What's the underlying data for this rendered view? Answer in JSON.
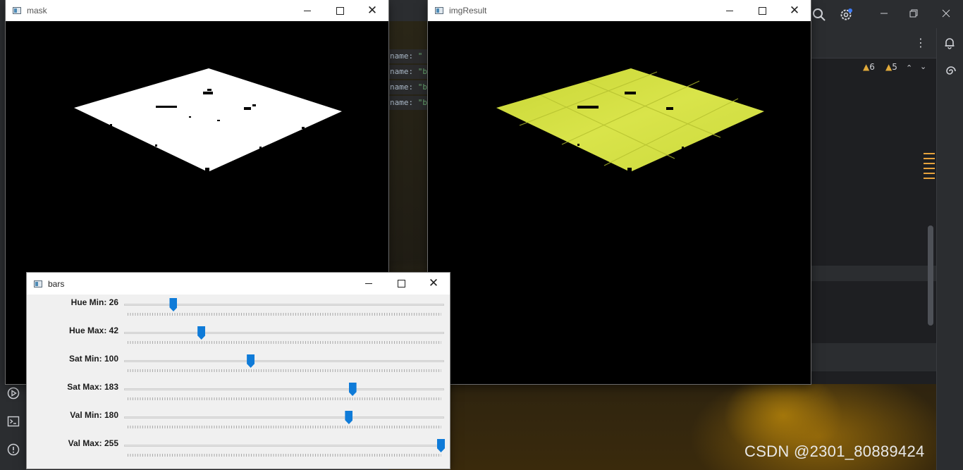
{
  "windows": {
    "mask": {
      "title": "mask"
    },
    "imgResult": {
      "title": "imgResult"
    },
    "bars": {
      "title": "bars"
    }
  },
  "sliders": [
    {
      "label": "Hue Min: 26",
      "value": 26,
      "max": 179
    },
    {
      "label": "Hue Max: 42",
      "value": 42,
      "max": 179
    },
    {
      "label": "Sat Min: 100",
      "value": 100,
      "max": 255
    },
    {
      "label": "Sat Max: 183",
      "value": 183,
      "max": 255
    },
    {
      "label": "Val Min: 180",
      "value": 180,
      "max": 255
    },
    {
      "label": "Val Max: 255",
      "value": 255,
      "max": 255
    }
  ],
  "ide": {
    "code_lines": [
      {
        "key": "name:",
        "value": "\""
      },
      {
        "key": "name:",
        "value": "\"b"
      },
      {
        "key": "name:",
        "value": "\"b"
      },
      {
        "key": "name:",
        "value": "\"b"
      }
    ],
    "warnings_count": "6",
    "weak_warnings_count": "5"
  },
  "icons": {
    "search": "search-icon",
    "settings": "gear-icon",
    "notifications": "bell-icon",
    "ai": "spiral-icon",
    "more": "kebab-icon",
    "run": "run-icon",
    "terminal": "terminal-icon",
    "problems": "warning-circle-icon"
  },
  "colors": {
    "slider_thumb": "#0f7bd8",
    "mask_fill": "#ffffff",
    "result_fill": "#d7e244",
    "warning": "#e0a93a"
  },
  "watermark": "CSDN @2301_80889424"
}
